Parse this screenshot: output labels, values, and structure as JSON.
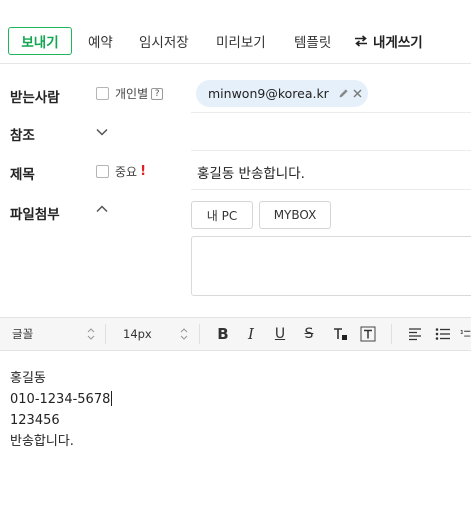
{
  "toolbar": {
    "send": "보내기",
    "reserve": "예약",
    "save_draft": "임시저장",
    "preview": "미리보기",
    "template": "템플릿",
    "send_to_self": "내게쓰기"
  },
  "header": {
    "to_label": "받는사람",
    "individual_label": "개인별",
    "individual_help": "?",
    "cc_label": "참조",
    "subject_label": "제목",
    "important_label": "중요",
    "important_mark": "!",
    "attach_label": "파일첨부"
  },
  "recipients": [
    {
      "address": "minwon9@korea.kr"
    }
  ],
  "subject_value": "홍길동 반송합니다.",
  "attachments": {
    "my_pc": "내 PC",
    "mybox": "MYBOX"
  },
  "editor": {
    "font_family": "글꼴",
    "font_size": "14px"
  },
  "body_lines": [
    "홍길동",
    "010-1234-5678",
    "123456",
    "반송합니다."
  ],
  "colors": {
    "accent": "#12a650",
    "chip_bg": "#e6f0fb",
    "important": "#e02020"
  },
  "icons": {
    "swap": "swap-arrows-icon",
    "edit": "pencil-icon",
    "remove": "close-icon",
    "chevron_down": "chevron-down-icon",
    "chevron_up": "chevron-up-icon"
  }
}
